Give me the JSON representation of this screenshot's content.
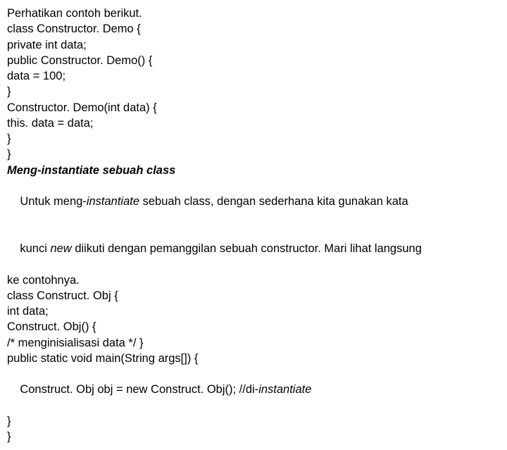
{
  "lines": [
    "Perhatikan contoh berikut.",
    "class Constructor. Demo {",
    "private int data;",
    "public Constructor. Demo() {",
    "data = 100;",
    "}",
    "Constructor. Demo(int data) {",
    "this. data = data;",
    "}",
    "}"
  ],
  "heading": "Meng-instantiate sebuah class",
  "para": {
    "p1a": "Untuk meng-",
    "p1b": "instantiate",
    "p1c": " sebuah class, dengan sederhana kita gunakan kata",
    "p2a": "kunci ",
    "p2b": "new",
    "p2c": " diikuti dengan pemanggilan sebuah constructor. Mari lihat langsung",
    "p3": "ke contohnya."
  },
  "code2": [
    "class Construct. Obj {",
    "int data;",
    "Construct. Obj() {",
    "/* menginisialisasi data */ }",
    "public static void main(String args[]) {"
  ],
  "inst": {
    "a": "Construct. Obj obj = new Construct. Obj(); //di-",
    "b": "instantiate"
  },
  "closers": [
    "}",
    "}"
  ]
}
